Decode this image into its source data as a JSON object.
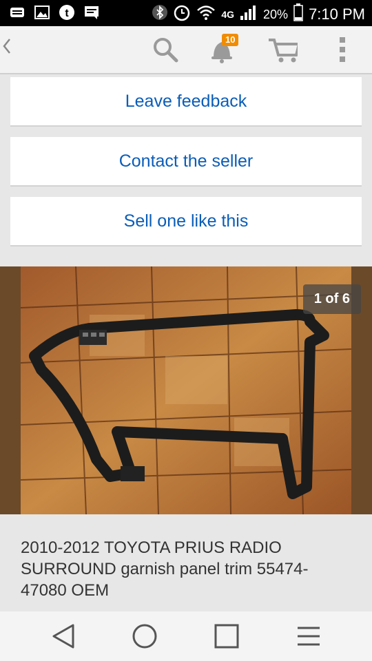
{
  "status_bar": {
    "network": "4G",
    "battery": "20%",
    "time": "7:10 PM"
  },
  "app_bar": {
    "back_icon": "chevron-left-icon",
    "notification_count": "10"
  },
  "actions": {
    "leave_feedback": "Leave feedback",
    "contact_seller": "Contact the seller",
    "sell_one": "Sell one like this"
  },
  "gallery": {
    "counter": "1 of 6"
  },
  "listing": {
    "title": "2010-2012 TOYOTA PRIUS RADIO SURROUND garnish panel trim 55474-47080 OEM"
  },
  "colors": {
    "link": "#0a5db8",
    "badge": "#f18c00"
  }
}
